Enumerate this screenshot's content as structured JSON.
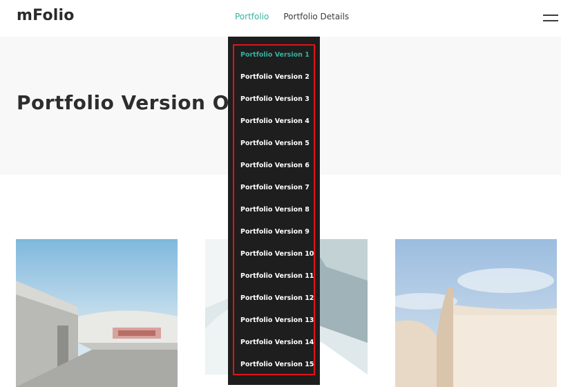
{
  "header": {
    "logo": "mFolio",
    "nav": [
      {
        "label": "Portfolio",
        "active": true
      },
      {
        "label": "Portfolio Details",
        "active": false
      }
    ],
    "menu_icon": "hamburger-menu-icon"
  },
  "hero": {
    "title": "Portfolio Version One"
  },
  "dropdown": {
    "items": [
      {
        "label": "Portfolio Version 1",
        "active": true
      },
      {
        "label": "Portfolio Version 2"
      },
      {
        "label": "Portfolio Version 3"
      },
      {
        "label": "Portfolio Version 4"
      },
      {
        "label": "Portfolio Version 5"
      },
      {
        "label": "Portfolio Version 6"
      },
      {
        "label": "Portfolio Version 7"
      },
      {
        "label": "Portfolio Version 8"
      },
      {
        "label": "Portfolio Version 9"
      },
      {
        "label": "Portfolio Version 10"
      },
      {
        "label": "Portfolio Version 11"
      },
      {
        "label": "Portfolio Version 12"
      },
      {
        "label": "Portfolio Version 13"
      },
      {
        "label": "Portfolio Version 14"
      },
      {
        "label": "Portfolio Version 15"
      }
    ]
  },
  "colors": {
    "accent": "#34b3a0",
    "dropdown_bg": "#1e1e1e",
    "highlight_border": "#e3121a",
    "hero_bg": "#f8f8f8"
  }
}
